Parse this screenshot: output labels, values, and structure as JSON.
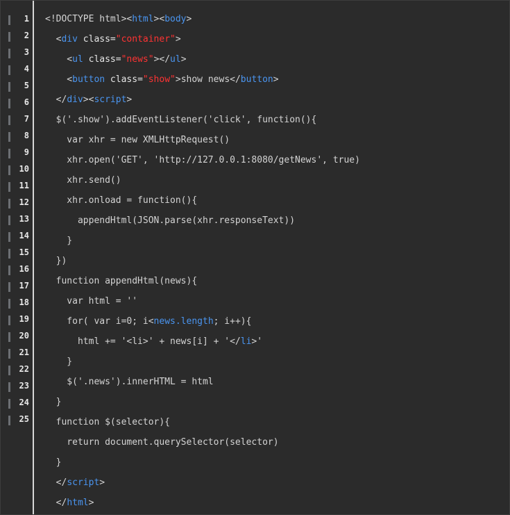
{
  "gutter": {
    "line_numbers": [
      "1",
      "2",
      "3",
      "4",
      "5",
      "6",
      "7",
      "8",
      "9",
      "10",
      "11",
      "12",
      "13",
      "14",
      "15",
      "16",
      "17",
      "18",
      "19",
      "20",
      "21",
      "22",
      "23",
      "24",
      "25"
    ]
  },
  "code": {
    "lines": [
      [
        {
          "t": "<!DOCTYPE html>",
          "c": "p"
        },
        {
          "t": "<",
          "c": "p"
        },
        {
          "t": "html",
          "c": "k"
        },
        {
          "t": "><",
          "c": "p"
        },
        {
          "t": "body",
          "c": "k"
        },
        {
          "t": ">",
          "c": "p"
        }
      ],
      [
        {
          "t": "  <",
          "c": "p"
        },
        {
          "t": "div",
          "c": "k"
        },
        {
          "t": " class=",
          "c": "a"
        },
        {
          "t": "\"container\"",
          "c": "s"
        },
        {
          "t": ">",
          "c": "p"
        }
      ],
      [
        {
          "t": "    <",
          "c": "p"
        },
        {
          "t": "ul",
          "c": "k"
        },
        {
          "t": " class=",
          "c": "a"
        },
        {
          "t": "\"news\"",
          "c": "s"
        },
        {
          "t": "></",
          "c": "p"
        },
        {
          "t": "ul",
          "c": "k"
        },
        {
          "t": ">",
          "c": "p"
        }
      ],
      [
        {
          "t": "    <",
          "c": "p"
        },
        {
          "t": "button",
          "c": "k"
        },
        {
          "t": " class=",
          "c": "a"
        },
        {
          "t": "\"show\"",
          "c": "s"
        },
        {
          "t": ">show news</",
          "c": "p"
        },
        {
          "t": "button",
          "c": "k"
        },
        {
          "t": ">",
          "c": "p"
        }
      ],
      [
        {
          "t": "  </",
          "c": "p"
        },
        {
          "t": "div",
          "c": "k"
        },
        {
          "t": "><",
          "c": "p"
        },
        {
          "t": "script",
          "c": "k"
        },
        {
          "t": ">",
          "c": "p"
        }
      ],
      [
        {
          "t": "  $('.show').addEventListener('click', function(){",
          "c": "p"
        }
      ],
      [
        {
          "t": "    var xhr = new XMLHttpRequest()",
          "c": "p"
        }
      ],
      [
        {
          "t": "    xhr.open('GET', 'http://127.0.0.1:8080/getNews', true)",
          "c": "p"
        }
      ],
      [
        {
          "t": "    xhr.send()",
          "c": "p"
        }
      ],
      [
        {
          "t": "    xhr.onload = function(){",
          "c": "p"
        }
      ],
      [
        {
          "t": "      appendHtml(JSON.parse(xhr.responseText))",
          "c": "p"
        }
      ],
      [
        {
          "t": "    }",
          "c": "p"
        }
      ],
      [
        {
          "t": "  })",
          "c": "p"
        }
      ],
      [
        {
          "t": "  function appendHtml(news){",
          "c": "p"
        }
      ],
      [
        {
          "t": "    var html = ''",
          "c": "p"
        }
      ],
      [
        {
          "t": "    for( var i=0; i<",
          "c": "p"
        },
        {
          "t": "news.length",
          "c": "m"
        },
        {
          "t": "; i++){",
          "c": "p"
        }
      ],
      [
        {
          "t": "      html += '<li>' + news[i] + '</",
          "c": "p"
        },
        {
          "t": "li",
          "c": "k"
        },
        {
          "t": ">'",
          "c": "p"
        }
      ],
      [
        {
          "t": "    }",
          "c": "p"
        }
      ],
      [
        {
          "t": "    $('.news').innerHTML = html",
          "c": "p"
        }
      ],
      [
        {
          "t": "  }",
          "c": "p"
        }
      ],
      [
        {
          "t": "  function $(selector){",
          "c": "p"
        }
      ],
      [
        {
          "t": "    return document.querySelector(selector)",
          "c": "p"
        }
      ],
      [
        {
          "t": "  }",
          "c": "p"
        }
      ],
      [
        {
          "t": "  </",
          "c": "p"
        },
        {
          "t": "script",
          "c": "k"
        },
        {
          "t": ">",
          "c": "p"
        }
      ],
      [
        {
          "t": "  </",
          "c": "p"
        },
        {
          "t": "html",
          "c": "k"
        },
        {
          "t": ">",
          "c": "p"
        }
      ]
    ]
  },
  "colors": {
    "background": "#2b2b2b",
    "tag": "#4a95f0",
    "string": "#ff3333",
    "text": "#d4d4d4",
    "gutter_text": "#e8e8e8"
  }
}
